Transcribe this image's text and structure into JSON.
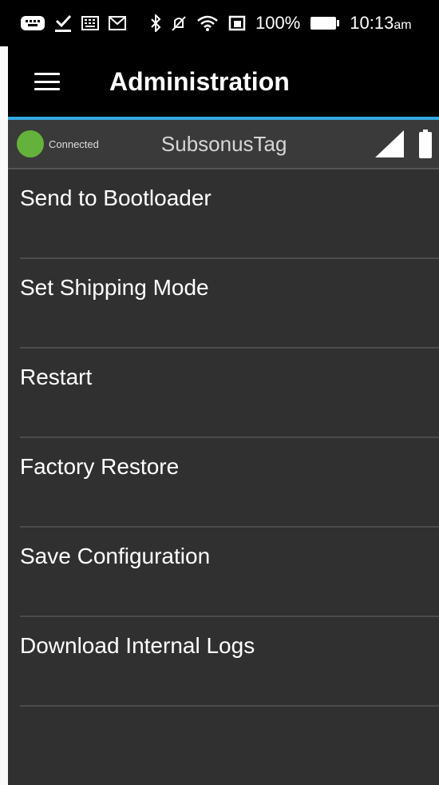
{
  "status_bar": {
    "battery_percent": "100%",
    "time": "10:13",
    "time_suffix": "am"
  },
  "app_bar": {
    "title": "Administration"
  },
  "device": {
    "connection_status": "Connected",
    "name": "SubsonusTag",
    "status_color": "#64b23c"
  },
  "menu": {
    "items": [
      {
        "label": "Send to Bootloader"
      },
      {
        "label": "Set Shipping Mode"
      },
      {
        "label": "Restart"
      },
      {
        "label": "Factory Restore"
      },
      {
        "label": "Save Configuration"
      },
      {
        "label": "Download Internal Logs"
      }
    ]
  },
  "theme": {
    "accent": "#35a8e0",
    "background": "#303030"
  }
}
